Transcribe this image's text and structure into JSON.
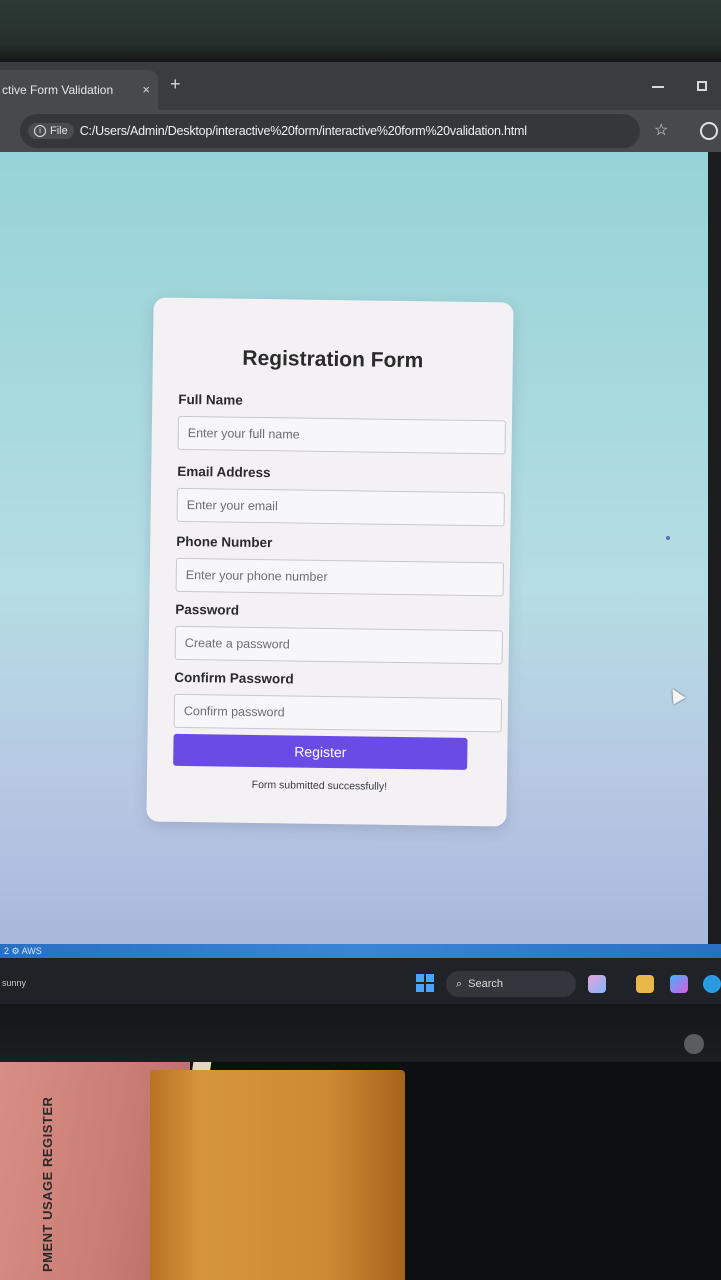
{
  "browser": {
    "tab_title": "ctive Form Validation",
    "tab_close": "×",
    "new_tab": "+",
    "info_label": "File",
    "url": "C:/Users/Admin/Desktop/interactive%20form/interactive%20form%20validation.html"
  },
  "form": {
    "title": "Registration Form",
    "fields": [
      {
        "label": "Full Name",
        "placeholder": "Enter your full name"
      },
      {
        "label": "Email Address",
        "placeholder": "Enter your email"
      },
      {
        "label": "Phone Number",
        "placeholder": "Enter your phone number"
      },
      {
        "label": "Password",
        "placeholder": "Create a password"
      },
      {
        "label": "Confirm Password",
        "placeholder": "Confirm password"
      }
    ],
    "submit_label": "Register",
    "message": "Form submitted successfully!"
  },
  "taskbar": {
    "strip_text": "2  ⚙  AWS",
    "user": "sunny",
    "search_label": "Search"
  },
  "desk": {
    "book_text": "PMENT USAGE REGISTER"
  },
  "colors": {
    "accent": "#6b4be6",
    "page_bg": "#a7d9de"
  }
}
